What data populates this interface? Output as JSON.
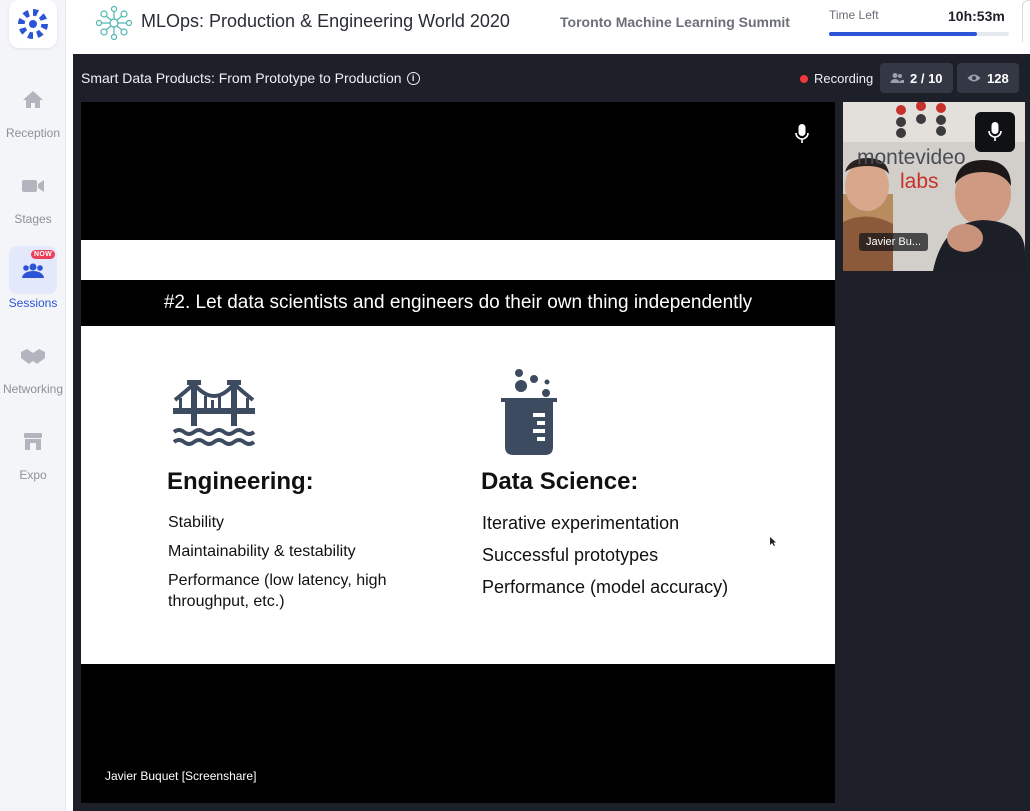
{
  "nav": {
    "items": [
      {
        "label": "Reception",
        "icon": "home-icon"
      },
      {
        "label": "Stages",
        "icon": "video-camera-icon"
      },
      {
        "label": "Sessions",
        "icon": "people-group-icon",
        "badge": "NOW"
      },
      {
        "label": "Networking",
        "icon": "handshake-icon"
      },
      {
        "label": "Expo",
        "icon": "booth-icon"
      }
    ]
  },
  "header": {
    "title": "MLOps: Production & Engineering World 2020",
    "subtitle": "Toronto Machine Learning Summit",
    "time_left_label": "Time Left",
    "time_left_value": "10h:53m",
    "time_progress": 0.82
  },
  "session": {
    "title": "Smart Data Products: From Prototype to Production",
    "recording_label": "Recording",
    "participants": "2 / 10",
    "viewers": "128"
  },
  "slide": {
    "heading": "#2. Let data scientists and engineers do their own thing independently",
    "left": {
      "title": "Engineering:",
      "items": [
        "Stability",
        "Maintainability & testability",
        "Performance (low latency, high throughput, etc.)"
      ]
    },
    "right": {
      "title": "Data Science:",
      "items": [
        "Iterative experimentation",
        "Successful prototypes",
        "Performance (model accuracy)"
      ]
    }
  },
  "screenshare_label": "Javier Buquet [Screenshare]",
  "tile": {
    "name": "Javier Bu...",
    "banner_line1": "montevideo",
    "banner_line2": "labs"
  },
  "colors": {
    "accent": "#2b55d6",
    "recording": "#f2383c",
    "badge": "#ea4058"
  }
}
